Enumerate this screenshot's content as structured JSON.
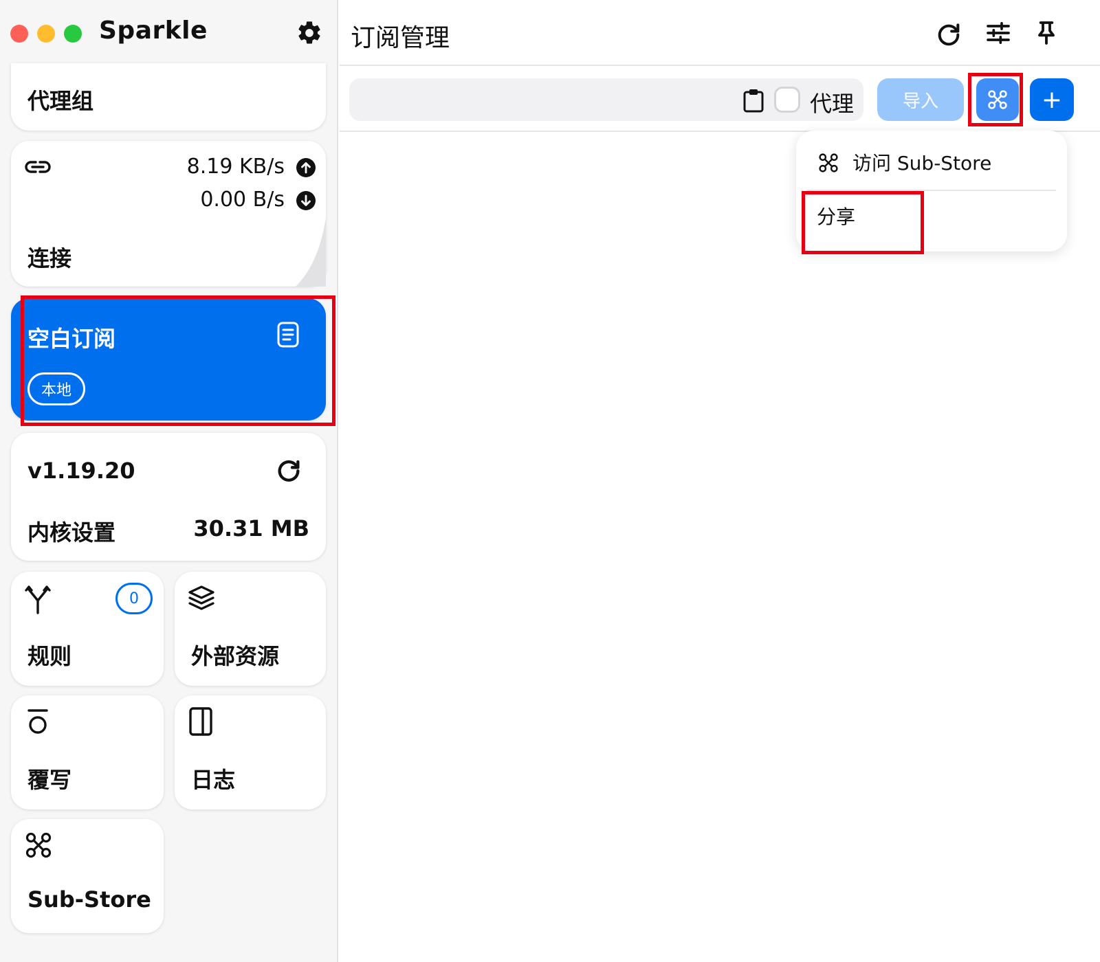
{
  "app": {
    "name": "Sparkle"
  },
  "sidebar": {
    "proxy_group": {
      "label": "代理组"
    },
    "connections": {
      "label": "连接",
      "upload_speed": "8.19 KB/s",
      "download_speed": "0.00 B/s"
    },
    "subscription": {
      "name": "空白订阅",
      "badge": "本地"
    },
    "core": {
      "version": "v1.19.20",
      "label": "内核设置",
      "memory": "30.31 MB"
    },
    "rules": {
      "label": "规则",
      "count": "0"
    },
    "resources": {
      "label": "外部资源"
    },
    "override": {
      "label": "覆写"
    },
    "logs": {
      "label": "日志"
    },
    "substore": {
      "label": "Sub-Store"
    }
  },
  "main": {
    "title": "订阅管理",
    "toolbar": {
      "proxy_label": "代理",
      "import_label": "导入",
      "add_label": "+"
    },
    "dropdown": {
      "visit_label": "访问 Sub-Store",
      "share_label": "分享"
    }
  },
  "colors": {
    "accent": "#006fee",
    "highlight": "#e60012"
  }
}
